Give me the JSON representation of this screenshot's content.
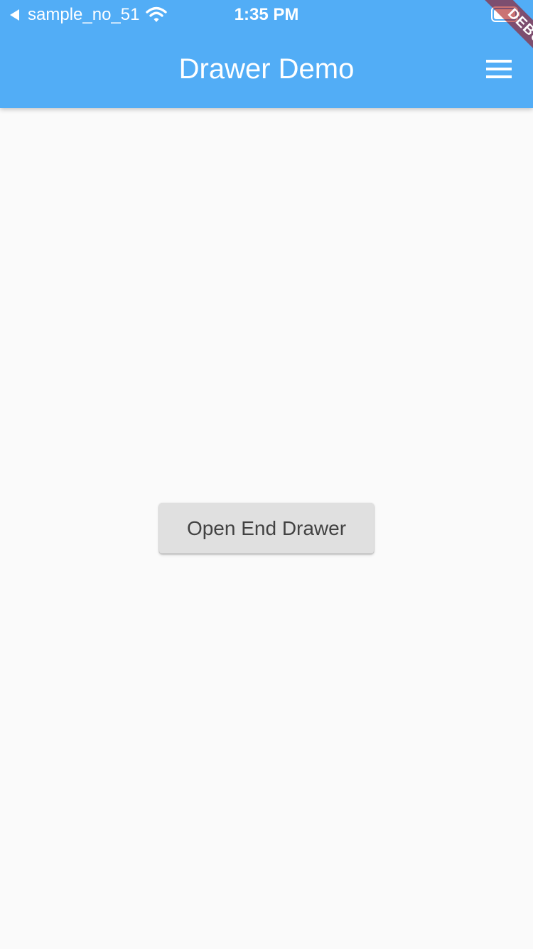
{
  "status_bar": {
    "back_app": "sample_no_51",
    "time": "1:35 PM",
    "icons": [
      "back-arrow-icon",
      "wifi-icon",
      "battery-icon"
    ]
  },
  "app_bar": {
    "title": "Drawer Demo",
    "menu_icon": "hamburger-menu-icon",
    "color": "#52adf6"
  },
  "debug_banner": {
    "label": "DEBUG"
  },
  "main": {
    "button_label": "Open End Drawer"
  }
}
